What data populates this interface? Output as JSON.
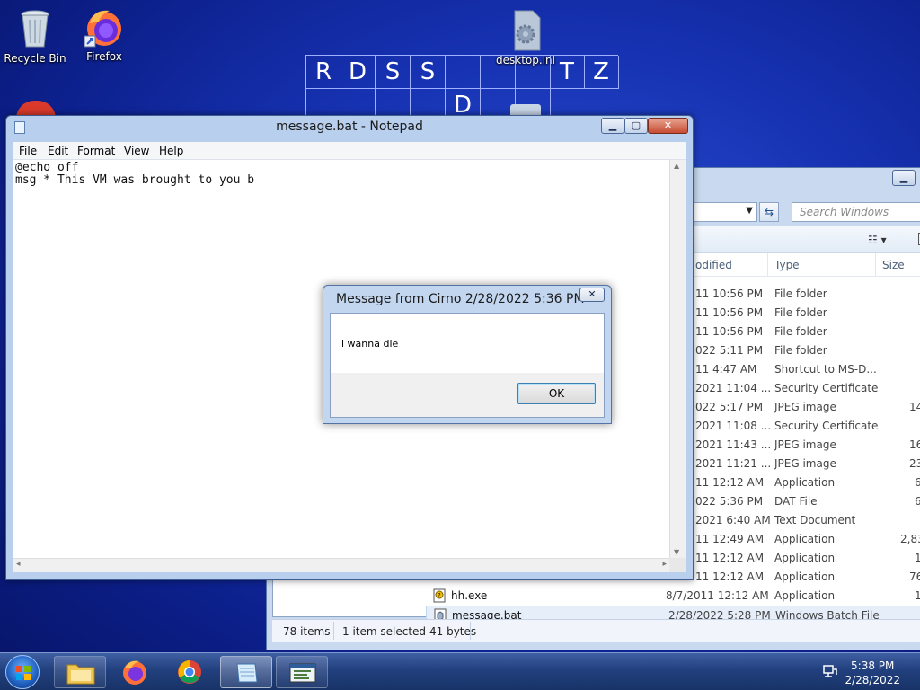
{
  "desktop": {
    "icons": [
      {
        "label": "Recycle Bin",
        "icon": "recycle-bin-icon"
      },
      {
        "label": "Firefox",
        "icon": "firefox-icon"
      },
      {
        "label": "desktop.ini",
        "icon": "settings-file-icon"
      }
    ],
    "wallpaper_letters": [
      "R",
      "D",
      "S",
      "S",
      "T",
      "Z",
      "D"
    ]
  },
  "notepad": {
    "title": "message.bat - Notepad",
    "menu": [
      "File",
      "Edit",
      "Format",
      "View",
      "Help"
    ],
    "text": "@echo off\nmsg * This VM was brought to you b"
  },
  "message_box": {
    "title": "Message from Cirno 2/28/2022 5:36 PM",
    "body": "i wanna die",
    "ok_label": "OK"
  },
  "explorer": {
    "search_placeholder": "Search Windows",
    "columns": {
      "modified": "odified",
      "type": "Type",
      "size": "Size"
    },
    "rows": [
      {
        "name": "",
        "modified": "11 10:56 PM",
        "type": "File folder",
        "size": ""
      },
      {
        "name": "",
        "modified": "11 10:56 PM",
        "type": "File folder",
        "size": ""
      },
      {
        "name": "",
        "modified": "11 10:56 PM",
        "type": "File folder",
        "size": ""
      },
      {
        "name": "",
        "modified": "022 5:11 PM",
        "type": "File folder",
        "size": ""
      },
      {
        "name": "",
        "modified": "11 4:47 AM",
        "type": "Shortcut to MS-D...",
        "size": ""
      },
      {
        "name": "",
        "modified": "2021 11:04 ...",
        "type": "Security Certificate",
        "size": ""
      },
      {
        "name": "",
        "modified": "022 5:17 PM",
        "type": "JPEG image",
        "size": "14"
      },
      {
        "name": "",
        "modified": "2021 11:08 ...",
        "type": "Security Certificate",
        "size": ""
      },
      {
        "name": "",
        "modified": "2021 11:43 ...",
        "type": "JPEG image",
        "size": "16"
      },
      {
        "name": "",
        "modified": "2021 11:21 ...",
        "type": "JPEG image",
        "size": "23"
      },
      {
        "name": "",
        "modified": "11 12:12 AM",
        "type": "Application",
        "size": "6"
      },
      {
        "name": "",
        "modified": "022 5:36 PM",
        "type": "DAT File",
        "size": "6"
      },
      {
        "name": "",
        "modified": "2021 6:40 AM",
        "type": "Text Document",
        "size": ""
      },
      {
        "name": "",
        "modified": "11 12:49 AM",
        "type": "Application",
        "size": "2,83"
      },
      {
        "name": "",
        "modified": "11 12:12 AM",
        "type": "Application",
        "size": "1"
      },
      {
        "name": "",
        "modified": "11 12:12 AM",
        "type": "Application",
        "size": "76"
      },
      {
        "name": "hh.exe",
        "modified": "8/7/2011 12:12 AM",
        "type": "Application",
        "size": "1"
      },
      {
        "name": "message.bat",
        "modified": "2/28/2022 5:28 PM",
        "type": "Windows Batch File",
        "size": ""
      }
    ],
    "status": {
      "items": "78 items",
      "selected": "1 item selected",
      "size": "41 bytes"
    }
  },
  "taskbar": {
    "apps": [
      "start-orb-icon",
      "explorer-icon",
      "firefox-icon",
      "chrome-icon",
      "notepad-icon",
      "console-window-icon"
    ],
    "time": "5:38 PM",
    "date": "2/28/2022"
  }
}
